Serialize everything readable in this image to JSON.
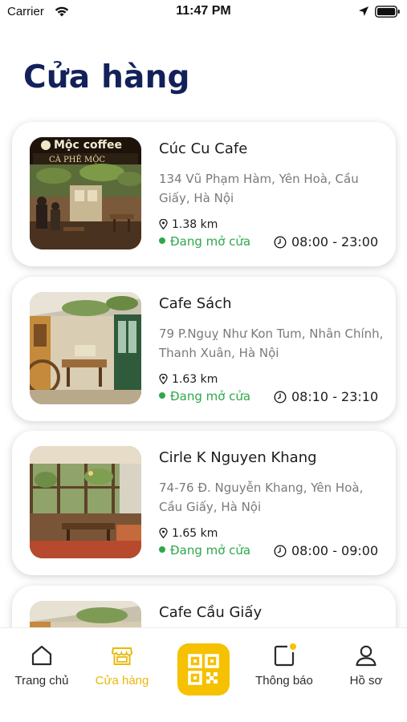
{
  "status_bar": {
    "carrier": "Carrier",
    "time": "11:47 PM"
  },
  "page": {
    "title": "Cửa hàng"
  },
  "stores": [
    {
      "name": "Cúc Cu Cafe",
      "address": "134 Vũ Phạm Hàm, Yên Hoà, Cầu Giấy, Hà Nội",
      "distance": "1.38 km",
      "status": "Đang mở cửa",
      "hours": "08:00 - 23:00",
      "photo_sign": "Mộc coffee",
      "photo_sign_sub": "CÀ PHÊ MỘC"
    },
    {
      "name": "Cafe Sách",
      "address": "79 P.Nguỵ Như Kon Tum, Nhân Chính, Thanh Xuân, Hà Nội",
      "distance": "1.63 km",
      "status": "Đang mở cửa",
      "hours": "08:10 - 23:10"
    },
    {
      "name": "Cirle K Nguyen Khang",
      "address": "74-76 Đ. Nguyễn Khang, Yên Hoà, Cầu Giấy, Hà Nội",
      "distance": "1.65 km",
      "status": "Đang mở cửa",
      "hours": "08:00 - 09:00"
    },
    {
      "name": "Cafe Cầu Giấy"
    }
  ],
  "tab_bar": {
    "home": "Trang chủ",
    "stores": "Cửa hàng",
    "notifications": "Thông báo",
    "profile": "Hồ sơ"
  },
  "colors": {
    "title": "#13215a",
    "accent": "#f5c100",
    "open_status": "#2ea84a"
  }
}
